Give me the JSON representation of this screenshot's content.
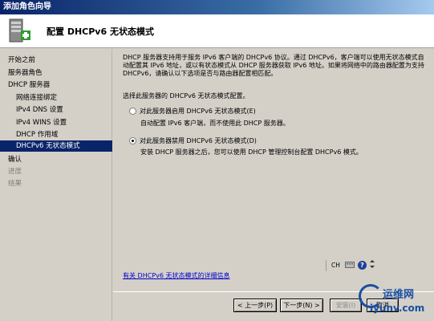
{
  "window": {
    "title": "添加角色向导"
  },
  "header": {
    "title": "配置 DHCPv6 无状态模式"
  },
  "sidebar": {
    "items": [
      {
        "label": "开始之前",
        "level": "top",
        "state": "normal"
      },
      {
        "label": "服务器角色",
        "level": "top",
        "state": "normal"
      },
      {
        "label": "DHCP 服务器",
        "level": "top",
        "state": "normal"
      },
      {
        "label": "网络连接绑定",
        "level": "sub",
        "state": "normal"
      },
      {
        "label": "IPv4 DNS 设置",
        "level": "sub",
        "state": "normal"
      },
      {
        "label": "IPv4 WINS 设置",
        "level": "sub",
        "state": "normal"
      },
      {
        "label": "DHCP 作用域",
        "level": "sub",
        "state": "normal"
      },
      {
        "label": "DHCPv6 无状态模式",
        "level": "sub",
        "state": "active"
      },
      {
        "label": "确认",
        "level": "top",
        "state": "normal"
      },
      {
        "label": "进度",
        "level": "top",
        "state": "disabled"
      },
      {
        "label": "结果",
        "level": "top",
        "state": "disabled"
      }
    ]
  },
  "content": {
    "description": "DHCP 服务器支持用于服务 IPv6 客户端的 DHCPv6 协议。通过 DHCPv6，客户端可以使用无状态模式自动配置其 IPv6 地址，或以有状态模式从 DHCP 服务器获取 IPv6 地址。如果将网络中的路由器配置为支持 DHCPv6，请确认以下选项是否与路由器配置相匹配。",
    "prompt": "选择此服务器的 DHCPv6 无状态模式配置。",
    "options": [
      {
        "label": "对此服务器启用 DHCPv6 无状态模式(E)",
        "desc": "自动配置 IPv6 客户端，而不使用此 DHCP 服务器。",
        "checked": false
      },
      {
        "label": "对此服务器禁用 DHCPv6 无状态模式(D)",
        "desc": "安装 DHCP 服务器之后，您可以使用 DHCP 管理控制台配置 DHCPv6 模式。",
        "checked": true
      }
    ],
    "lang_indicator": "CH",
    "more_link": "有关 DHCPv6 无状态模式的详细信息"
  },
  "buttons": {
    "prev": "< 上一步(P)",
    "next": "下一步(N) >",
    "install": "安装(I)",
    "cancel": "取消"
  },
  "watermark": {
    "text": "运维网",
    "url": "iyunv.com"
  }
}
